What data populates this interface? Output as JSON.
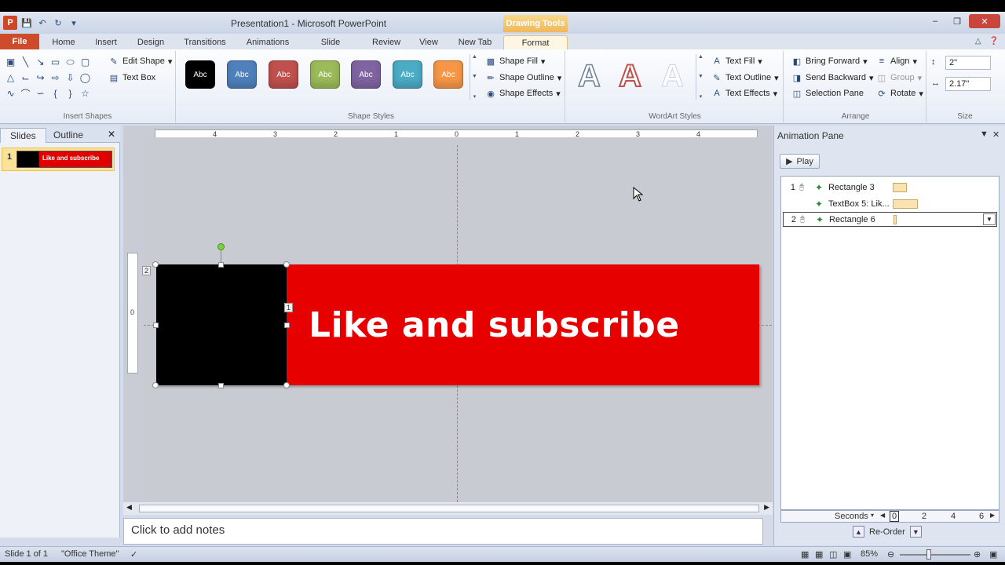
{
  "titlebar": {
    "window_title": "Presentation1 - Microsoft PowerPoint",
    "contextual_header": "Drawing Tools",
    "app_logo": "P",
    "qat_icons": [
      "save-icon",
      "undo-icon",
      "redo-icon",
      "customize-icon"
    ]
  },
  "tabs": {
    "file": "File",
    "home": "Home",
    "insert": "Insert",
    "design": "Design",
    "transitions": "Transitions",
    "animations": "Animations",
    "slide_show": "Slide Show",
    "review": "Review",
    "view": "View",
    "new_tab": "New Tab",
    "format": "Format"
  },
  "ribbon": {
    "insert_shapes": {
      "label": "Insert Shapes",
      "edit_shape": "Edit Shape",
      "text_box": "Text Box"
    },
    "shape_styles": {
      "label": "Shape Styles",
      "swatches": [
        {
          "text": "Abc",
          "color": "#000000"
        },
        {
          "text": "Abc",
          "color": "#4f81bd"
        },
        {
          "text": "Abc",
          "color": "#c0504d"
        },
        {
          "text": "Abc",
          "color": "#9bbb59"
        },
        {
          "text": "Abc",
          "color": "#8064a2"
        },
        {
          "text": "Abc",
          "color": "#4bacc6"
        },
        {
          "text": "Abc",
          "color": "#f79646"
        }
      ],
      "shape_fill": "Shape Fill",
      "shape_outline": "Shape Outline",
      "shape_effects": "Shape Effects"
    },
    "wordart_styles": {
      "label": "WordArt Styles",
      "letters": [
        "A",
        "A",
        "A"
      ],
      "text_fill": "Text Fill",
      "text_outline": "Text Outline",
      "text_effects": "Text Effects"
    },
    "arrange": {
      "label": "Arrange",
      "bring_forward": "Bring Forward",
      "send_backward": "Send Backward",
      "selection_pane": "Selection Pane",
      "align": "Align",
      "group": "Group",
      "rotate": "Rotate"
    },
    "size": {
      "label": "Size",
      "height": "2\"",
      "width": "2.17\""
    }
  },
  "left_pane": {
    "tab_slides": "Slides",
    "tab_outline": "Outline",
    "slide_number": "1",
    "thumbnail_text": "Like and subscribe"
  },
  "ruler": {
    "h_labels": [
      "4",
      "3",
      "2",
      "1",
      "0",
      "1",
      "2",
      "3",
      "4"
    ],
    "v_label": "0"
  },
  "slide": {
    "banner_text": "Like and subscribe",
    "banner_color": "#e60000",
    "block_color": "#000000",
    "anim_tag_1": "1",
    "anim_tag_2": "2"
  },
  "notes": {
    "placeholder": "Click to add notes"
  },
  "animation_pane": {
    "title": "Animation Pane",
    "play": "Play",
    "items": [
      {
        "num": "1",
        "name": "Rectangle 3"
      },
      {
        "num": "",
        "name": "TextBox 5: Lik..."
      },
      {
        "num": "2",
        "name": "Rectangle 6"
      }
    ],
    "seconds": "Seconds",
    "timeline": [
      "0",
      "2",
      "4",
      "6"
    ],
    "reorder": "Re-Order"
  },
  "statusbar": {
    "slide_info": "Slide 1 of 1",
    "theme": "\"Office Theme\"",
    "zoom": "85%"
  }
}
